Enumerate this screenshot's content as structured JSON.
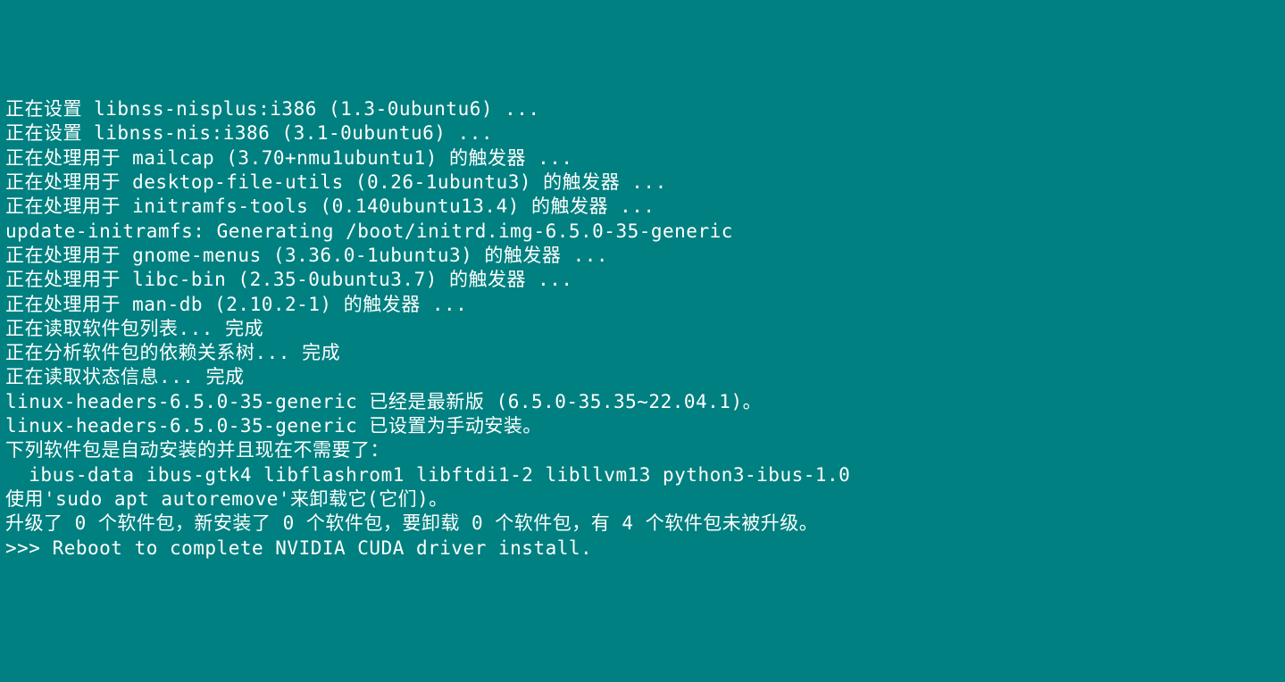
{
  "terminal": {
    "lines": [
      "正在设置 libnss-nisplus:i386 (1.3-0ubuntu6) ...",
      "正在设置 libnss-nis:i386 (3.1-0ubuntu6) ...",
      "正在处理用于 mailcap (3.70+nmu1ubuntu1) 的触发器 ...",
      "正在处理用于 desktop-file-utils (0.26-1ubuntu3) 的触发器 ...",
      "正在处理用于 initramfs-tools (0.140ubuntu13.4) 的触发器 ...",
      "update-initramfs: Generating /boot/initrd.img-6.5.0-35-generic",
      "正在处理用于 gnome-menus (3.36.0-1ubuntu3) 的触发器 ...",
      "正在处理用于 libc-bin (2.35-0ubuntu3.7) 的触发器 ...",
      "正在处理用于 man-db (2.10.2-1) 的触发器 ...",
      "正在读取软件包列表... 完成",
      "正在分析软件包的依赖关系树... 完成",
      "正在读取状态信息... 完成",
      "linux-headers-6.5.0-35-generic 已经是最新版 (6.5.0-35.35~22.04.1)。",
      "linux-headers-6.5.0-35-generic 已设置为手动安装。",
      "下列软件包是自动安装的并且现在不需要了：",
      "  ibus-data ibus-gtk4 libflashrom1 libftdi1-2 libllvm13 python3-ibus-1.0",
      "使用'sudo apt autoremove'来卸载它(它们)。",
      "升级了 0 个软件包，新安装了 0 个软件包，要卸载 0 个软件包，有 4 个软件包未被升级。",
      ">>> Reboot to complete NVIDIA CUDA driver install."
    ]
  }
}
